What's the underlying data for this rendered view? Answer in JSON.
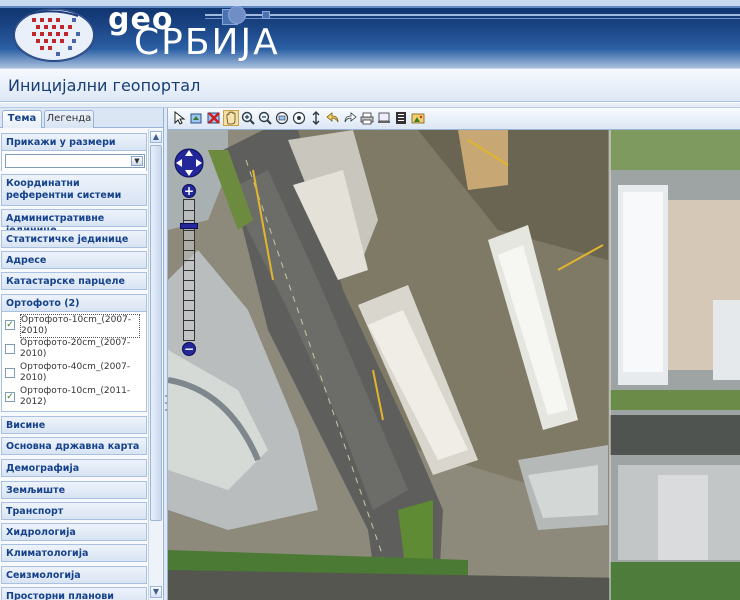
{
  "brand": {
    "logo_prefix": "geo",
    "logo_name": "СРБИЈА"
  },
  "page": {
    "title": "Иницијални геопортал"
  },
  "tabs": [
    {
      "label": "Тема",
      "active": true
    },
    {
      "label": "Легенда",
      "active": false
    }
  ],
  "sidebar": {
    "sections": {
      "scale": "Прикажи у размери",
      "crs": "Координатни референтни системи",
      "admin": "Административне јединице",
      "stat": "Статистичке јединице",
      "addr": "Адресе",
      "cadastre": "Катастарске парцеле",
      "ortho": "Ортофото (2)",
      "heights": "Висине",
      "basemap": "Основна државна карта",
      "demo": "Демографија",
      "land": "Земљиште",
      "transport": "Транспорт",
      "hydro": "Хидрологија",
      "climate": "Климатологија",
      "seismo": "Сеизмологија",
      "spatial": "Просторни планови"
    },
    "scale_select": {
      "value": ""
    },
    "ortho_layers": [
      {
        "label": "Ортофото-10cm_(2007-2010)",
        "checked": true
      },
      {
        "label": "Ортофото-20cm_(2007-2010)",
        "checked": false
      },
      {
        "label": "Ортофото-40cm_(2007-2010)",
        "checked": false
      },
      {
        "label": "Ортофото-10cm_(2011-2012)",
        "checked": true
      }
    ]
  },
  "toolbar": {
    "tools": [
      "select-arrow",
      "zoom-to-extent",
      "clear-selection",
      "pan-hand",
      "zoom-in",
      "zoom-out",
      "identify",
      "find",
      "refresh",
      "previous-extent",
      "next-extent",
      "print",
      "measure",
      "legend",
      "export"
    ],
    "active_tool": "pan-hand"
  },
  "map_controls": {
    "zoom_plus": "+",
    "zoom_minus": "−",
    "zoom_level": 0.18
  },
  "colors": {
    "banner": "#1b4585",
    "title_text": "#173e74",
    "section_text": "#15428b",
    "zoom_control": "#23279a"
  }
}
